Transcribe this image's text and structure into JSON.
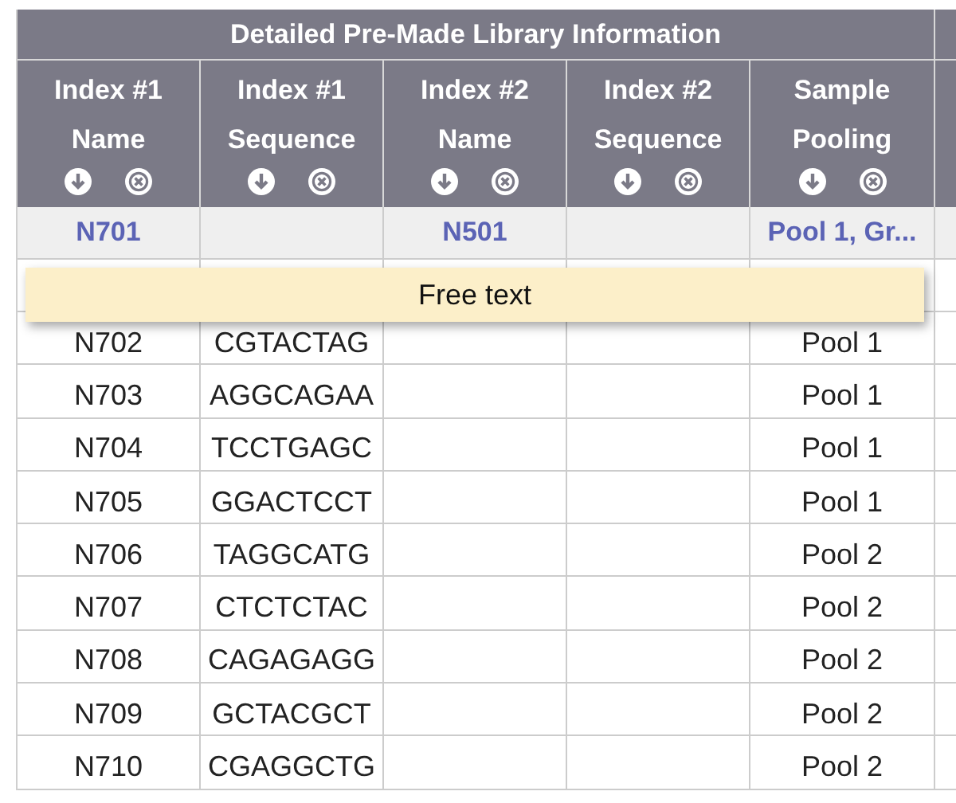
{
  "table": {
    "title": "Detailed Pre-Made Library Information",
    "columns": [
      {
        "label": [
          "Index #1",
          "Name"
        ]
      },
      {
        "label": [
          "Index #1",
          "Sequence"
        ]
      },
      {
        "label": [
          "Index #2",
          "Name"
        ]
      },
      {
        "label": [
          "Index #2",
          "Sequence"
        ]
      },
      {
        "label": [
          "Sample",
          "Pooling"
        ]
      }
    ],
    "filter_row": {
      "index1_name": "N701",
      "index2_name": "N501",
      "sample_pooling": "Pool 1, Gr..."
    },
    "rows": [
      {
        "index1_name": "N702",
        "index1_sequence": "CGTACTAG",
        "sample_pooling": "Pool 1"
      },
      {
        "index1_name": "N703",
        "index1_sequence": "AGGCAGAA",
        "sample_pooling": "Pool 1"
      },
      {
        "index1_name": "N704",
        "index1_sequence": "TCCTGAGC",
        "sample_pooling": "Pool 1"
      },
      {
        "index1_name": "N705",
        "index1_sequence": "GGACTCCT",
        "sample_pooling": "Pool 1"
      },
      {
        "index1_name": "N706",
        "index1_sequence": "TAGGCATG",
        "sample_pooling": "Pool 2"
      },
      {
        "index1_name": "N707",
        "index1_sequence": "CTCTCTAC",
        "sample_pooling": "Pool 2"
      },
      {
        "index1_name": "N708",
        "index1_sequence": "CAGAGAGG",
        "sample_pooling": "Pool 2"
      },
      {
        "index1_name": "N709",
        "index1_sequence": "GCTACGCT",
        "sample_pooling": "Pool 2"
      },
      {
        "index1_name": "N710",
        "index1_sequence": "CGAGGCTG",
        "sample_pooling": "Pool 2"
      }
    ]
  },
  "tooltip": {
    "text": "Free text"
  }
}
